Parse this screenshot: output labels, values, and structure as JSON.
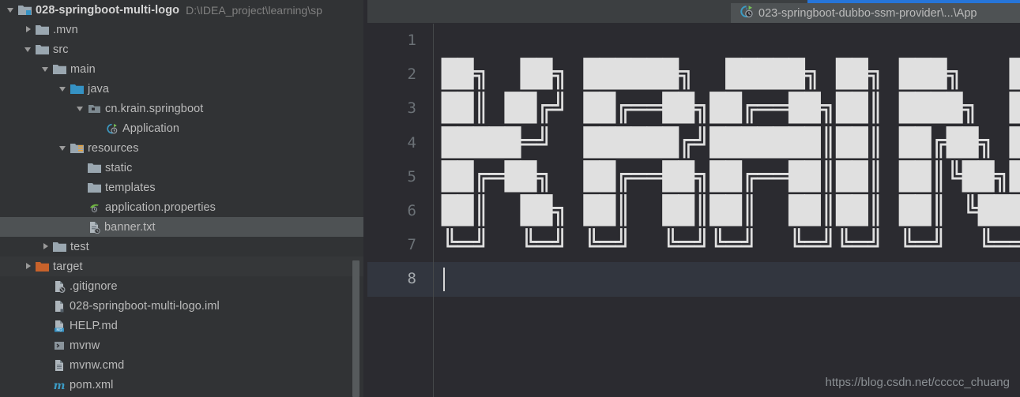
{
  "window": {
    "app": "IntelliJ IDEA",
    "theme_bg": "#3C3F41",
    "editor_bg": "#2B2B30",
    "sidebar_bg": "#313335",
    "selection_bg": "#4E5254",
    "accent_blue": "#2675D9"
  },
  "sidebar": {
    "name": "project-tree",
    "items": [
      {
        "label": "028-springboot-multi-logo",
        "path_hint": "D:\\IDEA_project\\learning\\sp",
        "indent": 0,
        "arrow": "expanded",
        "icon": "module-folder-icon",
        "bold": true,
        "state": "normal"
      },
      {
        "label": ".mvn",
        "path_hint": "",
        "indent": 1,
        "arrow": "collapsed",
        "icon": "folder-icon",
        "bold": false,
        "state": "normal"
      },
      {
        "label": "src",
        "path_hint": "",
        "indent": 1,
        "arrow": "expanded",
        "icon": "folder-icon",
        "bold": false,
        "state": "normal"
      },
      {
        "label": "main",
        "path_hint": "",
        "indent": 2,
        "arrow": "expanded",
        "icon": "folder-icon",
        "bold": false,
        "state": "normal"
      },
      {
        "label": "java",
        "path_hint": "",
        "indent": 3,
        "arrow": "expanded",
        "icon": "source-root-icon",
        "bold": false,
        "state": "normal"
      },
      {
        "label": "cn.krain.springboot",
        "path_hint": "",
        "indent": 4,
        "arrow": "expanded",
        "icon": "package-icon",
        "bold": false,
        "state": "normal"
      },
      {
        "label": "Application",
        "path_hint": "",
        "indent": 5,
        "arrow": "none",
        "icon": "spring-boot-icon",
        "bold": false,
        "state": "normal"
      },
      {
        "label": "resources",
        "path_hint": "",
        "indent": 3,
        "arrow": "expanded",
        "icon": "resource-root-icon",
        "bold": false,
        "state": "normal"
      },
      {
        "label": "static",
        "path_hint": "",
        "indent": 4,
        "arrow": "none",
        "icon": "folder-icon",
        "bold": false,
        "state": "normal"
      },
      {
        "label": "templates",
        "path_hint": "",
        "indent": 4,
        "arrow": "none",
        "icon": "folder-icon",
        "bold": false,
        "state": "normal"
      },
      {
        "label": "application.properties",
        "path_hint": "",
        "indent": 4,
        "arrow": "none",
        "icon": "spring-config-icon",
        "bold": false,
        "state": "normal"
      },
      {
        "label": "banner.txt",
        "path_hint": "",
        "indent": 4,
        "arrow": "none",
        "icon": "text-file-icon",
        "bold": false,
        "state": "selected"
      },
      {
        "label": "test",
        "path_hint": "",
        "indent": 2,
        "arrow": "collapsed",
        "icon": "folder-icon",
        "bold": false,
        "state": "normal"
      },
      {
        "label": "target",
        "path_hint": "",
        "indent": 1,
        "arrow": "collapsed",
        "icon": "target-folder-icon",
        "bold": false,
        "state": "hovered"
      },
      {
        "label": ".gitignore",
        "path_hint": "",
        "indent": 2,
        "arrow": "none",
        "icon": "gitignore-icon",
        "bold": false,
        "state": "normal"
      },
      {
        "label": "028-springboot-multi-logo.iml",
        "path_hint": "",
        "indent": 2,
        "arrow": "none",
        "icon": "iml-file-icon",
        "bold": false,
        "state": "normal"
      },
      {
        "label": "HELP.md",
        "path_hint": "",
        "indent": 2,
        "arrow": "none",
        "icon": "markdown-icon",
        "bold": false,
        "state": "normal"
      },
      {
        "label": "mvnw",
        "path_hint": "",
        "indent": 2,
        "arrow": "none",
        "icon": "shell-script-icon",
        "bold": false,
        "state": "normal"
      },
      {
        "label": "mvnw.cmd",
        "path_hint": "",
        "indent": 2,
        "arrow": "none",
        "icon": "cmd-file-icon",
        "bold": false,
        "state": "normal"
      },
      {
        "label": "pom.xml",
        "path_hint": "",
        "indent": 2,
        "arrow": "none",
        "icon": "maven-icon",
        "bold": false,
        "state": "normal"
      }
    ]
  },
  "editor": {
    "tab": {
      "label": "023-springboot-dubbo-ssm-provider\\...\\App",
      "icon": "spring-boot-icon"
    },
    "line_numbers": [
      "1",
      "2",
      "3",
      "4",
      "5",
      "6",
      "7",
      "8"
    ],
    "active_line": 8,
    "lines": [
      "",
      "██╗  ██╗ ██████╗  █████╗ ██╗ ███╗   ██╗",
      "██║ ██╔╝ ██╔══██╗██╔══██╗██║ ████╗  ██║",
      "█████═╝  ██████╔╝███████║██║ ██╔██╗ ██║",
      "██╔═██╗  ██╔══██╗██╔══██║██║ ██║╚██╗██║",
      "██║  ██╗ ██║  ██║██║  ██║██║ ██║ ╚████║",
      "╚═╝  ╚═╝ ╚═╝  ╚═╝╚═╝  ╚═╝╚═╝ ╚═╝  ╚═══╝",
      ""
    ],
    "watermark": "https://blog.csdn.net/ccccc_chuang"
  }
}
